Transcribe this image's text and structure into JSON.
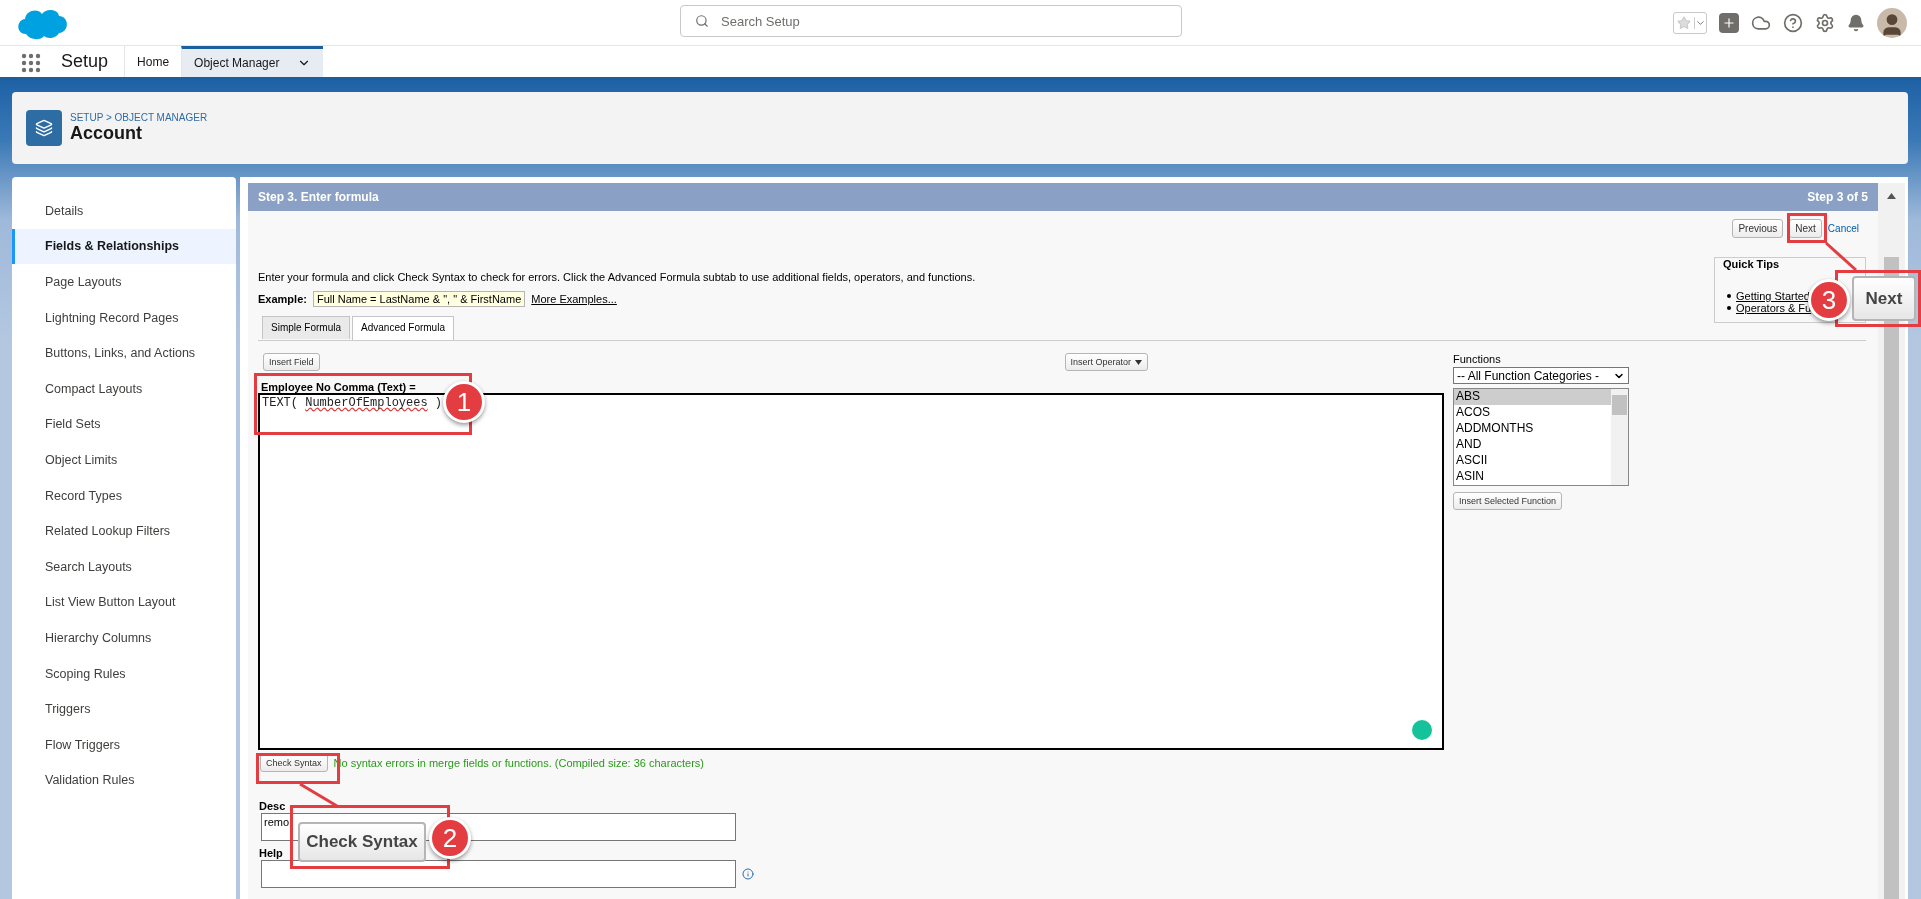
{
  "header": {
    "search_placeholder": "Search Setup"
  },
  "nav": {
    "app_name": "Setup",
    "tabs": [
      {
        "label": "Home",
        "selected": false
      },
      {
        "label": "Object Manager",
        "selected": true
      }
    ]
  },
  "page_header": {
    "breadcrumb": "SETUP > OBJECT MANAGER",
    "title": "Account"
  },
  "sidebar": {
    "items": [
      {
        "label": "Details",
        "selected": false
      },
      {
        "label": "Fields & Relationships",
        "selected": true
      },
      {
        "label": "Page Layouts",
        "selected": false
      },
      {
        "label": "Lightning Record Pages",
        "selected": false
      },
      {
        "label": "Buttons, Links, and Actions",
        "selected": false
      },
      {
        "label": "Compact Layouts",
        "selected": false
      },
      {
        "label": "Field Sets",
        "selected": false
      },
      {
        "label": "Object Limits",
        "selected": false
      },
      {
        "label": "Record Types",
        "selected": false
      },
      {
        "label": "Related Lookup Filters",
        "selected": false
      },
      {
        "label": "Search Layouts",
        "selected": false
      },
      {
        "label": "List View Button Layout",
        "selected": false
      },
      {
        "label": "Hierarchy Columns",
        "selected": false
      },
      {
        "label": "Scoping Rules",
        "selected": false
      },
      {
        "label": "Triggers",
        "selected": false
      },
      {
        "label": "Flow Triggers",
        "selected": false
      },
      {
        "label": "Validation Rules",
        "selected": false
      }
    ]
  },
  "wizard": {
    "title": "Step 3. Enter formula",
    "step": "Step 3 of 5",
    "buttons": [
      "Previous",
      "Next"
    ],
    "cancel": "Cancel",
    "instructions": "Enter your formula and click Check Syntax to check for errors. Click the Advanced Formula subtab to use additional fields, operators, and functions.",
    "example_label": "Example:",
    "example": "Full Name = LastName & \", \" & FirstName",
    "more_examples": "More Examples...",
    "quick_tips": {
      "title": "Quick Tips",
      "links": [
        "Getting Started",
        "Operators & Fu"
      ]
    },
    "formula_tabs": [
      {
        "label": "Simple Formula",
        "selected": false
      },
      {
        "label": "Advanced Formula",
        "selected": true
      }
    ],
    "insert_field": "Insert Field",
    "insert_operator": "Insert Operator",
    "field_label": "Employee No Comma (Text) =",
    "formula": [
      {
        "text": "TEXT( ",
        "flagged": false
      },
      {
        "text": "NumberOfEmployees",
        "flagged": true
      },
      {
        "text": " )",
        "flagged": false
      }
    ],
    "functions": {
      "label": "Functions",
      "category": "-- All Function Categories -",
      "items": [
        {
          "label": "ABS",
          "selected": true
        },
        {
          "label": "ACOS",
          "selected": false
        },
        {
          "label": "ADDMONTHS",
          "selected": false
        },
        {
          "label": "AND",
          "selected": false
        },
        {
          "label": "ASCII",
          "selected": false
        },
        {
          "label": "ASIN",
          "selected": false
        }
      ],
      "insert_button": "Insert Selected Function"
    },
    "check_syntax": "Check Syntax",
    "syntax_message": "No syntax errors in merge fields or functions. (Compiled size: 36 characters)",
    "description": {
      "label": "Desc",
      "value": "remo"
    },
    "help": {
      "label": "Help"
    }
  },
  "annotations": [
    {
      "number": "1"
    },
    {
      "number": "2",
      "callout": "Check Syntax"
    },
    {
      "number": "3",
      "callout": "Next"
    }
  ]
}
